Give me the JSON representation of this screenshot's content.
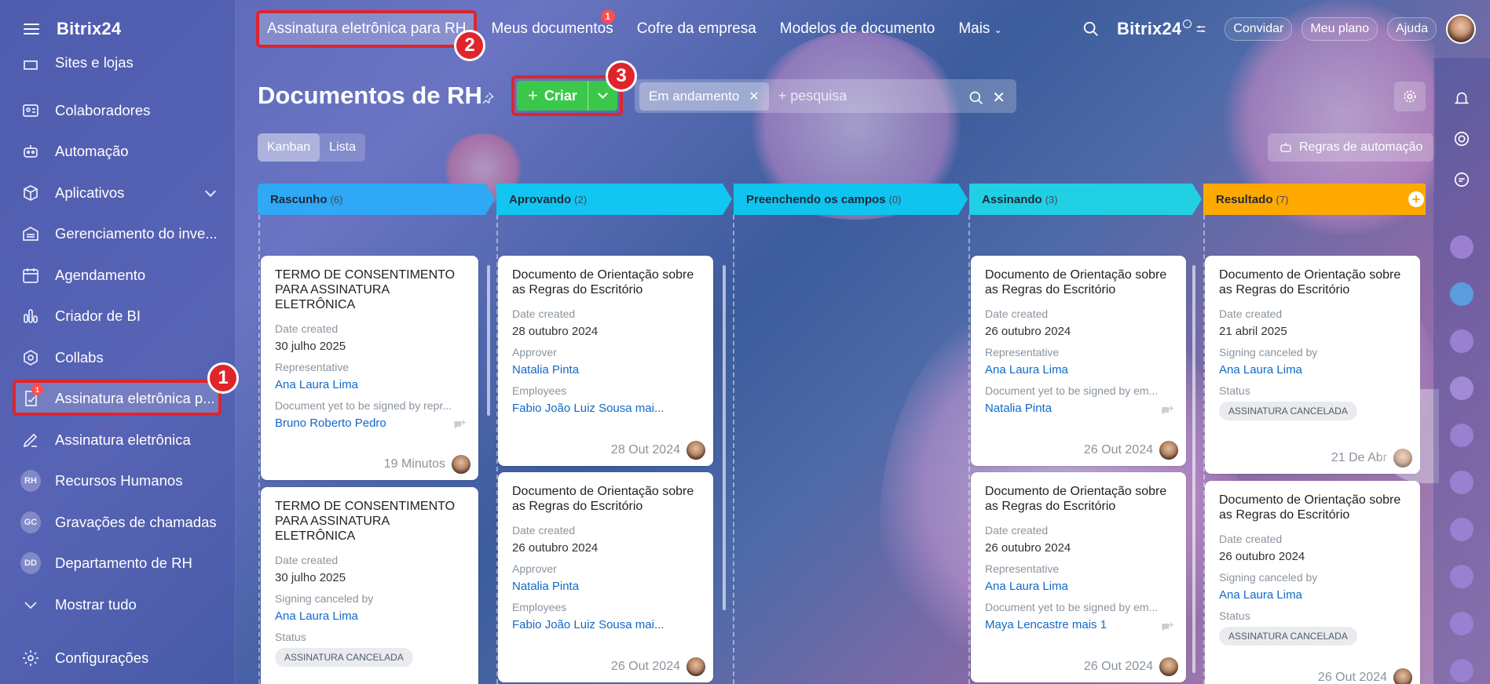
{
  "sidebar": {
    "brand": "Bitrix24",
    "items": [
      {
        "label": "Sites e lojas"
      },
      {
        "label": "Colaboradores"
      },
      {
        "label": "Automação"
      },
      {
        "label": "Aplicativos"
      },
      {
        "label": "Gerenciamento do inve..."
      },
      {
        "label": "Agendamento"
      },
      {
        "label": "Criador de BI"
      },
      {
        "label": "Collabs"
      },
      {
        "label": "Assinatura eletrônica p...",
        "badge": "1"
      },
      {
        "label": "Assinatura eletrônica"
      },
      {
        "label": "Recursos Humanos",
        "initials": "RH"
      },
      {
        "label": "Gravações de chamadas",
        "initials": "GC"
      },
      {
        "label": "Departamento de RH",
        "initials": "DD"
      },
      {
        "label": "Mostrar tudo"
      },
      {
        "label": "Configurações"
      }
    ]
  },
  "callouts": {
    "c1": "1",
    "c2": "2",
    "c3": "3"
  },
  "topnav": {
    "tabs": [
      {
        "label": "Assinatura eletrônica para RH"
      },
      {
        "label": "Meus documentos",
        "badge": "1"
      },
      {
        "label": "Cofre da empresa"
      },
      {
        "label": "Modelos de documento"
      },
      {
        "label": "Mais"
      }
    ],
    "brand": "Bitrix24",
    "invite": "Convidar",
    "plan": "Meu plano",
    "help": "Ajuda"
  },
  "page": {
    "title": "Documentos de RH",
    "create_label": "Criar",
    "filter_chip": "Em andamento",
    "search_placeholder": "+ pesquisa",
    "view_kanban": "Kanban",
    "view_list": "Lista",
    "automation_rules": "Regras de automação"
  },
  "columns": [
    {
      "name": "Rascunho",
      "count": "(6)",
      "color": "#2fa8f5"
    },
    {
      "name": "Aprovando",
      "count": "(2)",
      "color": "#12c6f1"
    },
    {
      "name": "Preenchendo os campos",
      "count": "(0)",
      "color": "#0fc4ee"
    },
    {
      "name": "Assinando",
      "count": "(3)",
      "color": "#21d1e3"
    },
    {
      "name": "Resultado",
      "count": "(7)",
      "color": "#ffa900"
    }
  ],
  "cards": {
    "r1": {
      "title": "TERMO DE CONSENTIMENTO PARA ASSINATURA ELETRÔNICA",
      "l1": "Date created",
      "v1": "30 julho 2025",
      "l2": "Representative",
      "v2": "Ana Laura Lima",
      "l3": "Document yet to be signed by repr...",
      "v3": "Bruno Roberto Pedro",
      "time": "19 Minutos"
    },
    "r2": {
      "title": "TERMO DE CONSENTIMENTO PARA ASSINATURA ELETRÔNICA",
      "l1": "Date created",
      "v1": "30 julho 2025",
      "l2": "Signing canceled by",
      "v2": "Ana Laura Lima",
      "l3": "Status",
      "v3": "ASSINATURA CANCELADA"
    },
    "a1": {
      "title": "Documento de Orientação sobre as Regras do Escritório",
      "l1": "Date created",
      "v1": "28 outubro 2024",
      "l2": "Approver",
      "v2": "Natalia Pinta",
      "l3": "Employees",
      "v3": "Fabio João Luiz Sousa mai...",
      "time": "28 Out 2024"
    },
    "a2": {
      "title": "Documento de Orientação sobre as Regras do Escritório",
      "l1": "Date created",
      "v1": "26 outubro 2024",
      "l2": "Approver",
      "v2": "Natalia Pinta",
      "l3": "Employees",
      "v3": "Fabio João Luiz Sousa mai...",
      "time": "26 Out 2024"
    },
    "s1": {
      "title": "Documento de Orientação sobre as Regras do Escritório",
      "l1": "Date created",
      "v1": "26 outubro 2024",
      "l2": "Representative",
      "v2": "Ana Laura Lima",
      "l3": "Document yet to be signed by em...",
      "v3": "Natalia Pinta",
      "time": "26 Out 2024"
    },
    "s2": {
      "title": "Documento de Orientação sobre as Regras do Escritório",
      "l1": "Date created",
      "v1": "26 outubro 2024",
      "l2": "Representative",
      "v2": "Ana Laura Lima",
      "l3": "Document yet to be signed by em...",
      "v3": "Maya Lencastre mais 1",
      "time": "26 Out 2024"
    },
    "d1": {
      "title": "Documento de Orientação sobre as Regras do Escritório",
      "l1": "Date created",
      "v1": "21 abril 2025",
      "l2": "Signing canceled by",
      "v2": "Ana Laura Lima",
      "l3": "Status",
      "v3": "ASSINATURA CANCELADA",
      "time": "21 De Abr"
    },
    "d2": {
      "title": "Documento de Orientação sobre as Regras do Escritório",
      "l1": "Date created",
      "v1": "26 outubro 2024",
      "l2": "Signing canceled by",
      "v2": "Ana Laura Lima",
      "l3": "Status",
      "v3": "ASSINATURA CANCELADA",
      "time": "26 Out 2024"
    }
  }
}
